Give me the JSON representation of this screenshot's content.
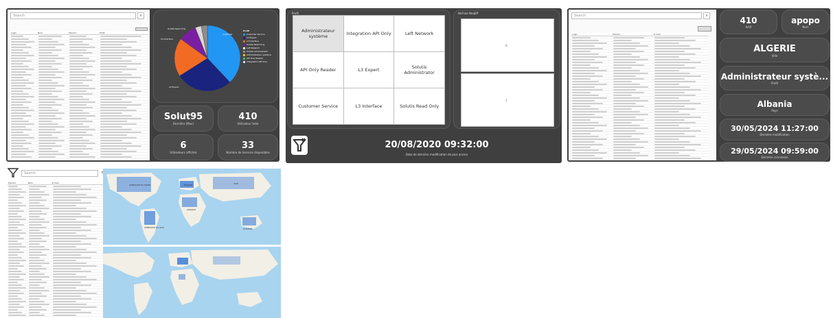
{
  "panel1": {
    "search_placeholder": "Search",
    "columns": [
      "Login",
      "Nom",
      "Prénom",
      "Profil"
    ],
    "pie": {
      "legend_title": "Profil",
      "legend": [
        {
          "label": "Customer Service",
          "color": "#2196f3"
        },
        {
          "label": "L3 Expert",
          "color": "#1a237e"
        },
        {
          "label": "L3 Interface",
          "color": "#f26b25"
        },
        {
          "label": "Solutis Read Only",
          "color": "#7b1fa2"
        },
        {
          "label": "Left Network",
          "color": "#ffffff"
        },
        {
          "label": "Solutis Administrator",
          "color": "#8d8d8d"
        },
        {
          "label": "Administrateur système",
          "color": "#f0c419"
        },
        {
          "label": "API Only Reader",
          "color": "#3fbf5f"
        },
        {
          "label": "Integration API Only",
          "color": "#c5e1f5"
        }
      ],
      "slices": [
        {
          "label": "Customer Service",
          "value": 38,
          "color": "#2196f3"
        },
        {
          "label": "L3 Expert",
          "value": 28,
          "color": "#1a237e"
        },
        {
          "label": "L3 Interface",
          "value": 19,
          "color": "#f26b25"
        },
        {
          "label": "Solutis Read Only",
          "value": 9,
          "color": "#7b1fa2"
        },
        {
          "label": "Left Network",
          "value": 3,
          "color": "#d9d9d9"
        },
        {
          "label": "Solutis Administrator",
          "value": 3,
          "color": "#8d8d8d"
        }
      ],
      "callouts": [
        "Customer",
        "L3 Interface",
        "Solutis Read Only",
        "L3 Expert"
      ]
    },
    "cards": [
      {
        "value": "Solut95",
        "sub": "Dernière (Max)"
      },
      {
        "value": "410",
        "sub": "Utilisateur total"
      },
      {
        "value": "6",
        "sub": "Utilisateurs affichés"
      },
      {
        "value": "33",
        "sub": "Nombre de licences disponibles"
      }
    ]
  },
  "panel2": {
    "profil_title": "Profil",
    "profiles": [
      "Administrateur système",
      "Integration API Only",
      "Left Network",
      "API Only Reader",
      "L3 Expert",
      "Solutis Administrator",
      "Customer Service",
      "L3 Interface",
      "Solutis Read Only"
    ],
    "nofsee_title": "NoFsee NeqEff",
    "values": [
      "0",
      "1"
    ],
    "date": "20/08/2020 09:32:00",
    "date_sub": "Date de dernière modification de plus ancien"
  },
  "panel3": {
    "search_placeholder": "Search",
    "columns": [
      "Login",
      "Prénom",
      "E-mail"
    ],
    "cards": [
      {
        "value": "410",
        "sub": "Actif"
      },
      {
        "value": "apopo",
        "sub": "Nom"
      },
      {
        "value": "ALGERIE",
        "sub": "Ville"
      },
      {
        "value": "Administrateur systè...",
        "sub": "Profil"
      },
      {
        "value": "Albania",
        "sub": "Pays"
      },
      {
        "value": "30/05/2024 11:27:00",
        "sub": "Dernière modification"
      },
      {
        "value": "29/05/2024 09:59:00",
        "sub": "Dernière connexion"
      }
    ]
  },
  "panel4": {
    "search_placeholder": "Search",
    "columns": [
      "Prénom",
      "Nom",
      "E-mail"
    ],
    "map_labels": [
      "AMÉRIQUE DU NORD",
      "EUROPE",
      "ASIE",
      "AFRIQUE",
      "AMÉRIQUE DU SUD",
      "OCÉANIE"
    ]
  },
  "colors": {
    "panel": "#3f3f3f",
    "card": "#4b4b4b",
    "ocean": "#a8d4ef",
    "land": "#f2efe6",
    "highlight": "#3b7dd8"
  }
}
